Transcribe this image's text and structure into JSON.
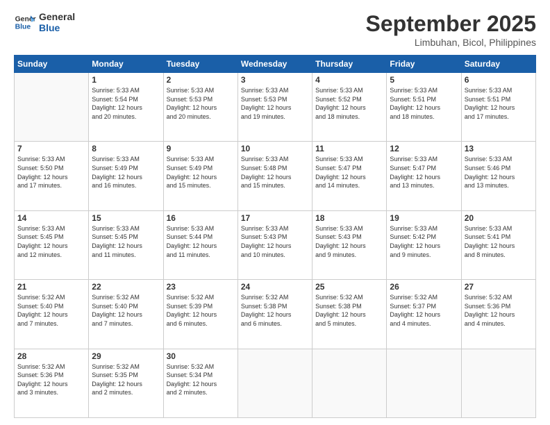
{
  "header": {
    "logo_line1": "General",
    "logo_line2": "Blue",
    "month": "September 2025",
    "location": "Limbuhan, Bicol, Philippines"
  },
  "weekdays": [
    "Sunday",
    "Monday",
    "Tuesday",
    "Wednesday",
    "Thursday",
    "Friday",
    "Saturday"
  ],
  "weeks": [
    [
      {
        "day": "",
        "info": ""
      },
      {
        "day": "1",
        "info": "Sunrise: 5:33 AM\nSunset: 5:54 PM\nDaylight: 12 hours\nand 20 minutes."
      },
      {
        "day": "2",
        "info": "Sunrise: 5:33 AM\nSunset: 5:53 PM\nDaylight: 12 hours\nand 20 minutes."
      },
      {
        "day": "3",
        "info": "Sunrise: 5:33 AM\nSunset: 5:53 PM\nDaylight: 12 hours\nand 19 minutes."
      },
      {
        "day": "4",
        "info": "Sunrise: 5:33 AM\nSunset: 5:52 PM\nDaylight: 12 hours\nand 18 minutes."
      },
      {
        "day": "5",
        "info": "Sunrise: 5:33 AM\nSunset: 5:51 PM\nDaylight: 12 hours\nand 18 minutes."
      },
      {
        "day": "6",
        "info": "Sunrise: 5:33 AM\nSunset: 5:51 PM\nDaylight: 12 hours\nand 17 minutes."
      }
    ],
    [
      {
        "day": "7",
        "info": "Sunrise: 5:33 AM\nSunset: 5:50 PM\nDaylight: 12 hours\nand 17 minutes."
      },
      {
        "day": "8",
        "info": "Sunrise: 5:33 AM\nSunset: 5:49 PM\nDaylight: 12 hours\nand 16 minutes."
      },
      {
        "day": "9",
        "info": "Sunrise: 5:33 AM\nSunset: 5:49 PM\nDaylight: 12 hours\nand 15 minutes."
      },
      {
        "day": "10",
        "info": "Sunrise: 5:33 AM\nSunset: 5:48 PM\nDaylight: 12 hours\nand 15 minutes."
      },
      {
        "day": "11",
        "info": "Sunrise: 5:33 AM\nSunset: 5:47 PM\nDaylight: 12 hours\nand 14 minutes."
      },
      {
        "day": "12",
        "info": "Sunrise: 5:33 AM\nSunset: 5:47 PM\nDaylight: 12 hours\nand 13 minutes."
      },
      {
        "day": "13",
        "info": "Sunrise: 5:33 AM\nSunset: 5:46 PM\nDaylight: 12 hours\nand 13 minutes."
      }
    ],
    [
      {
        "day": "14",
        "info": "Sunrise: 5:33 AM\nSunset: 5:45 PM\nDaylight: 12 hours\nand 12 minutes."
      },
      {
        "day": "15",
        "info": "Sunrise: 5:33 AM\nSunset: 5:45 PM\nDaylight: 12 hours\nand 11 minutes."
      },
      {
        "day": "16",
        "info": "Sunrise: 5:33 AM\nSunset: 5:44 PM\nDaylight: 12 hours\nand 11 minutes."
      },
      {
        "day": "17",
        "info": "Sunrise: 5:33 AM\nSunset: 5:43 PM\nDaylight: 12 hours\nand 10 minutes."
      },
      {
        "day": "18",
        "info": "Sunrise: 5:33 AM\nSunset: 5:43 PM\nDaylight: 12 hours\nand 9 minutes."
      },
      {
        "day": "19",
        "info": "Sunrise: 5:33 AM\nSunset: 5:42 PM\nDaylight: 12 hours\nand 9 minutes."
      },
      {
        "day": "20",
        "info": "Sunrise: 5:33 AM\nSunset: 5:41 PM\nDaylight: 12 hours\nand 8 minutes."
      }
    ],
    [
      {
        "day": "21",
        "info": "Sunrise: 5:32 AM\nSunset: 5:40 PM\nDaylight: 12 hours\nand 7 minutes."
      },
      {
        "day": "22",
        "info": "Sunrise: 5:32 AM\nSunset: 5:40 PM\nDaylight: 12 hours\nand 7 minutes."
      },
      {
        "day": "23",
        "info": "Sunrise: 5:32 AM\nSunset: 5:39 PM\nDaylight: 12 hours\nand 6 minutes."
      },
      {
        "day": "24",
        "info": "Sunrise: 5:32 AM\nSunset: 5:38 PM\nDaylight: 12 hours\nand 6 minutes."
      },
      {
        "day": "25",
        "info": "Sunrise: 5:32 AM\nSunset: 5:38 PM\nDaylight: 12 hours\nand 5 minutes."
      },
      {
        "day": "26",
        "info": "Sunrise: 5:32 AM\nSunset: 5:37 PM\nDaylight: 12 hours\nand 4 minutes."
      },
      {
        "day": "27",
        "info": "Sunrise: 5:32 AM\nSunset: 5:36 PM\nDaylight: 12 hours\nand 4 minutes."
      }
    ],
    [
      {
        "day": "28",
        "info": "Sunrise: 5:32 AM\nSunset: 5:36 PM\nDaylight: 12 hours\nand 3 minutes."
      },
      {
        "day": "29",
        "info": "Sunrise: 5:32 AM\nSunset: 5:35 PM\nDaylight: 12 hours\nand 2 minutes."
      },
      {
        "day": "30",
        "info": "Sunrise: 5:32 AM\nSunset: 5:34 PM\nDaylight: 12 hours\nand 2 minutes."
      },
      {
        "day": "",
        "info": ""
      },
      {
        "day": "",
        "info": ""
      },
      {
        "day": "",
        "info": ""
      },
      {
        "day": "",
        "info": ""
      }
    ]
  ]
}
